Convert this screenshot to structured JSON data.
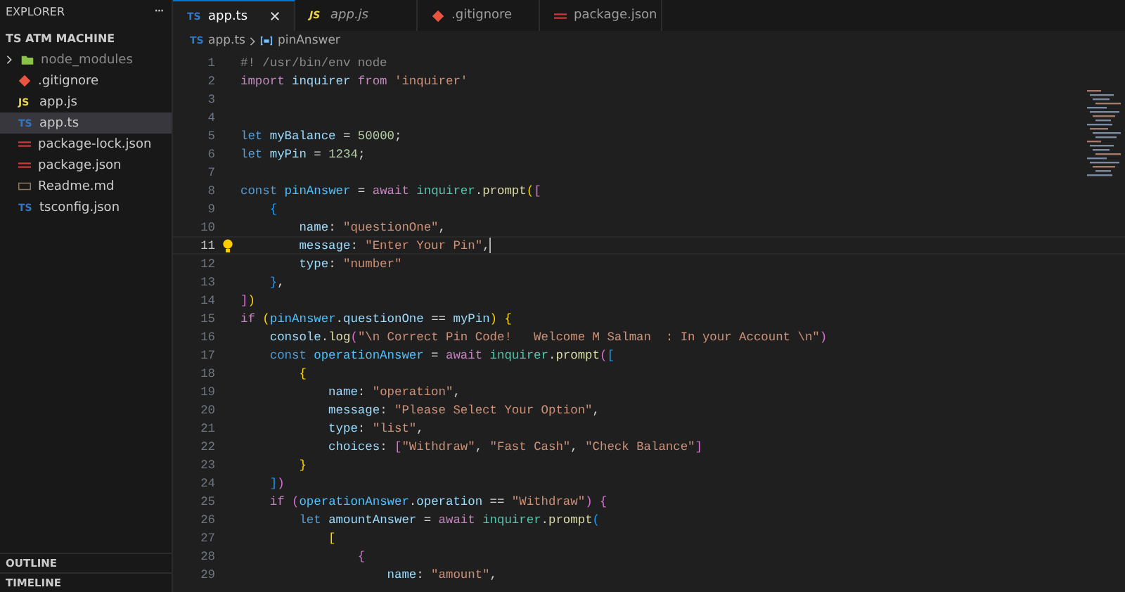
{
  "sidebar": {
    "title": "EXPLORER",
    "more": "···",
    "folder": "TS ATM MACHINE",
    "items": [
      {
        "label": "node_modules",
        "kind": "folder",
        "selected": false
      },
      {
        "label": ".gitignore",
        "kind": "git",
        "selected": false
      },
      {
        "label": "app.js",
        "kind": "js",
        "icon_text": "JS",
        "selected": false
      },
      {
        "label": "app.ts",
        "kind": "ts",
        "icon_text": "TS",
        "selected": true
      },
      {
        "label": "package-lock.json",
        "kind": "npm",
        "selected": false
      },
      {
        "label": "package.json",
        "kind": "npm",
        "selected": false
      },
      {
        "label": "Readme.md",
        "kind": "md",
        "selected": false
      },
      {
        "label": "tsconfig.json",
        "kind": "ts",
        "icon_text": "TS",
        "selected": false
      }
    ],
    "panels": [
      "OUTLINE",
      "TIMELINE"
    ]
  },
  "tabs": [
    {
      "label": "app.ts",
      "kind": "ts",
      "icon_text": "TS",
      "selected": true,
      "preview": false
    },
    {
      "label": "app.js",
      "kind": "js",
      "icon_text": "JS",
      "selected": false,
      "preview": true
    },
    {
      "label": ".gitignore",
      "kind": "git",
      "selected": false,
      "preview": false
    },
    {
      "label": "package.json",
      "kind": "npm",
      "selected": false,
      "preview": false
    }
  ],
  "breadcrumb": {
    "icon_text": "TS",
    "file": "app.ts",
    "symbol": "pinAnswer"
  },
  "editor": {
    "lines": [
      {
        "n": "1",
        "current": false,
        "tokens": [
          {
            "text": "#! /usr/bin/env node",
            "kind": "cmt"
          }
        ]
      },
      {
        "n": "2",
        "current": false,
        "tokens": [
          {
            "text": "import",
            "kind": "ctl"
          },
          {
            "text": " inquirer",
            "kind": "var"
          },
          {
            "text": " from",
            "kind": "ctl"
          },
          {
            "text": " 'inquirer'",
            "kind": "str"
          }
        ]
      },
      {
        "n": "3",
        "current": false
      },
      {
        "n": "4",
        "current": false
      },
      {
        "n": "5",
        "current": false,
        "tokens": [
          {
            "text": "let",
            "kind": "kw"
          },
          {
            "text": " myBalance",
            "kind": "var"
          },
          {
            "text": " =",
            "kind": "p"
          },
          {
            "text": " 50000",
            "kind": "num"
          },
          {
            "text": ";",
            "kind": "p"
          }
        ]
      },
      {
        "n": "6",
        "current": false,
        "tokens": [
          {
            "text": "let",
            "kind": "kw"
          },
          {
            "text": " myPin",
            "kind": "var"
          },
          {
            "text": " =",
            "kind": "p"
          },
          {
            "text": " 1234",
            "kind": "num"
          },
          {
            "text": ";",
            "kind": "p"
          }
        ]
      },
      {
        "n": "7",
        "current": false
      },
      {
        "n": "8",
        "current": false,
        "tokens": [
          {
            "text": "const",
            "kind": "kw"
          },
          {
            "text": " pinAnswer",
            "kind": "con"
          },
          {
            "text": " =",
            "kind": "p"
          },
          {
            "text": " await",
            "kind": "ctl"
          },
          {
            "text": " inquirer",
            "kind": "type"
          },
          {
            "text": ".",
            "kind": "p"
          },
          {
            "text": "prompt",
            "kind": "fn"
          },
          {
            "text": "(",
            "kind": "b1"
          },
          {
            "text": "[",
            "kind": "b2"
          }
        ]
      },
      {
        "n": "9",
        "current": false,
        "tokens": [
          {
            "text": "    {",
            "kind": "b3"
          }
        ]
      },
      {
        "n": "10",
        "current": false,
        "tokens": [
          {
            "text": "        name",
            "kind": "prop"
          },
          {
            "text": ":",
            "kind": "p"
          },
          {
            "text": " \"questionOne\"",
            "kind": "str"
          },
          {
            "text": ",",
            "kind": "p"
          }
        ]
      },
      {
        "n": "11",
        "current": true,
        "tokens": [
          {
            "text": "        message",
            "kind": "prop"
          },
          {
            "text": ":",
            "kind": "p"
          },
          {
            "text": " \"Enter Your Pin\"",
            "kind": "str"
          },
          {
            "text": ",",
            "kind": "p"
          }
        ]
      },
      {
        "n": "12",
        "current": false,
        "tokens": [
          {
            "text": "        type",
            "kind": "prop"
          },
          {
            "text": ":",
            "kind": "p"
          },
          {
            "text": " \"number\"",
            "kind": "str"
          }
        ]
      },
      {
        "n": "13",
        "current": false,
        "tokens": [
          {
            "text": "    }",
            "kind": "b3"
          },
          {
            "text": ",",
            "kind": "p"
          }
        ]
      },
      {
        "n": "14",
        "current": false,
        "tokens": [
          {
            "text": "]",
            "kind": "b2"
          },
          {
            "text": ")",
            "kind": "b1"
          }
        ]
      },
      {
        "n": "15",
        "current": false,
        "tokens": [
          {
            "text": "if",
            "kind": "ctl"
          },
          {
            "text": " (",
            "kind": "b1"
          },
          {
            "text": "pinAnswer",
            "kind": "con"
          },
          {
            "text": ".",
            "kind": "p"
          },
          {
            "text": "questionOne",
            "kind": "prop"
          },
          {
            "text": " ==",
            "kind": "p"
          },
          {
            "text": " myPin",
            "kind": "var"
          },
          {
            "text": ")",
            "kind": "b1"
          },
          {
            "text": " {",
            "kind": "b1"
          }
        ]
      },
      {
        "n": "16",
        "current": false,
        "tokens": [
          {
            "text": "    console",
            "kind": "var"
          },
          {
            "text": ".",
            "kind": "p"
          },
          {
            "text": "log",
            "kind": "fn"
          },
          {
            "text": "(",
            "kind": "b2"
          },
          {
            "text": "\"\\n Correct Pin Code!   Welcome M Salman  : In your Account \\n\"",
            "kind": "str"
          },
          {
            "text": ")",
            "kind": "b2"
          }
        ]
      },
      {
        "n": "17",
        "current": false,
        "tokens": [
          {
            "text": "    const",
            "kind": "kw"
          },
          {
            "text": " operationAnswer",
            "kind": "con"
          },
          {
            "text": " =",
            "kind": "p"
          },
          {
            "text": " await",
            "kind": "ctl"
          },
          {
            "text": " inquirer",
            "kind": "type"
          },
          {
            "text": ".",
            "kind": "p"
          },
          {
            "text": "prompt",
            "kind": "fn"
          },
          {
            "text": "(",
            "kind": "b2"
          },
          {
            "text": "[",
            "kind": "b3"
          }
        ]
      },
      {
        "n": "18",
        "current": false,
        "tokens": [
          {
            "text": "        {",
            "kind": "b1"
          }
        ]
      },
      {
        "n": "19",
        "current": false,
        "tokens": [
          {
            "text": "            name",
            "kind": "prop"
          },
          {
            "text": ":",
            "kind": "p"
          },
          {
            "text": " \"operation\"",
            "kind": "str"
          },
          {
            "text": ",",
            "kind": "p"
          }
        ]
      },
      {
        "n": "20",
        "current": false,
        "tokens": [
          {
            "text": "            message",
            "kind": "prop"
          },
          {
            "text": ":",
            "kind": "p"
          },
          {
            "text": " \"Please Select Your Option\"",
            "kind": "str"
          },
          {
            "text": ",",
            "kind": "p"
          }
        ]
      },
      {
        "n": "21",
        "current": false,
        "tokens": [
          {
            "text": "            type",
            "kind": "prop"
          },
          {
            "text": ":",
            "kind": "p"
          },
          {
            "text": " \"list\"",
            "kind": "str"
          },
          {
            "text": ",",
            "kind": "p"
          }
        ]
      },
      {
        "n": "22",
        "current": false,
        "tokens": [
          {
            "text": "            choices",
            "kind": "prop"
          },
          {
            "text": ":",
            "kind": "p"
          },
          {
            "text": " [",
            "kind": "b2"
          },
          {
            "text": "\"Withdraw\"",
            "kind": "str"
          },
          {
            "text": ",",
            "kind": "p"
          },
          {
            "text": " \"Fast Cash\"",
            "kind": "str"
          },
          {
            "text": ",",
            "kind": "p"
          },
          {
            "text": " \"Check Balance\"",
            "kind": "str"
          },
          {
            "text": "]",
            "kind": "b2"
          }
        ]
      },
      {
        "n": "23",
        "current": false,
        "tokens": [
          {
            "text": "        }",
            "kind": "b1"
          }
        ]
      },
      {
        "n": "24",
        "current": false,
        "tokens": [
          {
            "text": "    ]",
            "kind": "b3"
          },
          {
            "text": ")",
            "kind": "b2"
          }
        ]
      },
      {
        "n": "25",
        "current": false,
        "tokens": [
          {
            "text": "    if",
            "kind": "ctl"
          },
          {
            "text": " (",
            "kind": "b2"
          },
          {
            "text": "operationAnswer",
            "kind": "con"
          },
          {
            "text": ".",
            "kind": "p"
          },
          {
            "text": "operation",
            "kind": "prop"
          },
          {
            "text": " ==",
            "kind": "p"
          },
          {
            "text": " \"Withdraw\"",
            "kind": "str"
          },
          {
            "text": ")",
            "kind": "b2"
          },
          {
            "text": " {",
            "kind": "b2"
          }
        ]
      },
      {
        "n": "26",
        "current": false,
        "tokens": [
          {
            "text": "        let",
            "kind": "kw"
          },
          {
            "text": " amountAnswer",
            "kind": "var"
          },
          {
            "text": " =",
            "kind": "p"
          },
          {
            "text": " await",
            "kind": "ctl"
          },
          {
            "text": " inquirer",
            "kind": "type"
          },
          {
            "text": ".",
            "kind": "p"
          },
          {
            "text": "prompt",
            "kind": "fn"
          },
          {
            "text": "(",
            "kind": "b3"
          }
        ]
      },
      {
        "n": "27",
        "current": false,
        "tokens": [
          {
            "text": "            [",
            "kind": "b1"
          }
        ]
      },
      {
        "n": "28",
        "current": false,
        "tokens": [
          {
            "text": "                {",
            "kind": "b2"
          }
        ]
      },
      {
        "n": "29",
        "current": false,
        "tokens": [
          {
            "text": "                    name",
            "kind": "prop"
          },
          {
            "text": ":",
            "kind": "p"
          },
          {
            "text": " \"amount\"",
            "kind": "str"
          },
          {
            "text": ",",
            "kind": "p"
          }
        ]
      }
    ]
  }
}
